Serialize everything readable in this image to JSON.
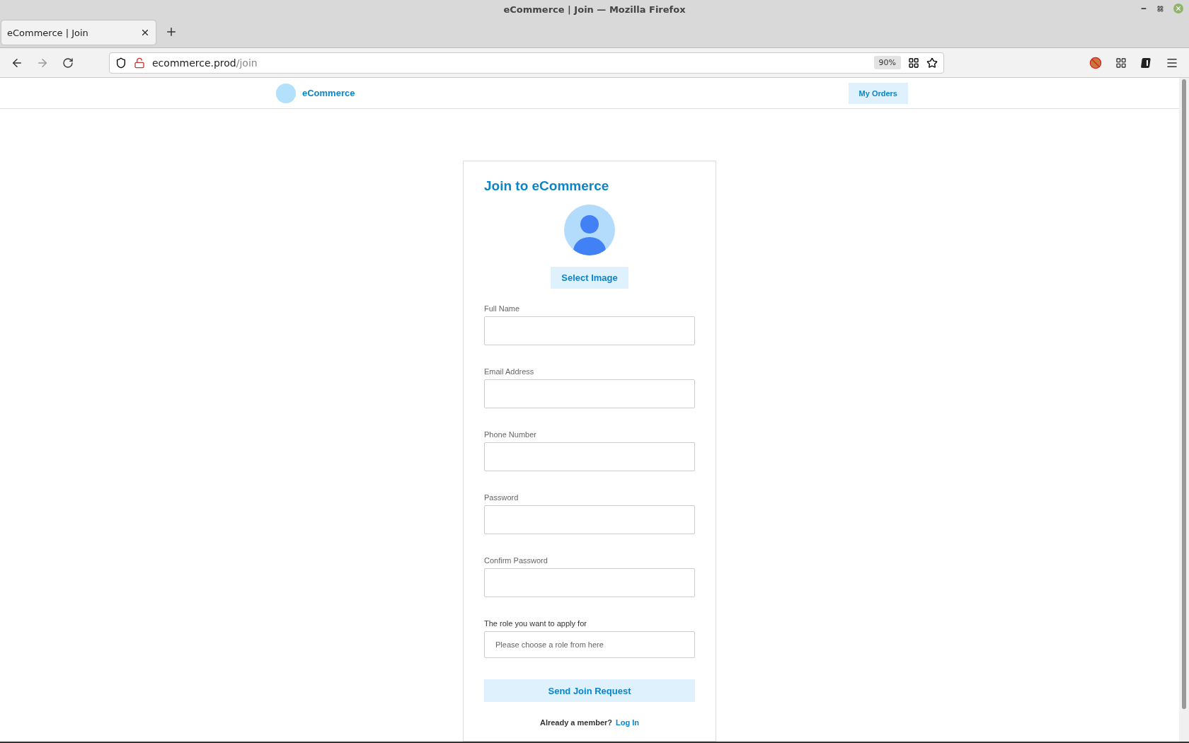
{
  "window": {
    "title": "eCommerce | Join — Mozilla Firefox"
  },
  "tabs": [
    {
      "label": "eCommerce | Join",
      "selected": true
    }
  ],
  "address_bar": {
    "host": "ecommerce.prod",
    "path": "/join",
    "zoom": "90%"
  },
  "header": {
    "brand": "eCommerce",
    "nav_button": "My Orders"
  },
  "form": {
    "title": "Join to eCommerce",
    "select_image": "Select Image",
    "fields": [
      {
        "label": "Full Name",
        "kind": "input"
      },
      {
        "label": "Email Address",
        "kind": "input"
      },
      {
        "label": "Phone Number",
        "kind": "input"
      },
      {
        "label": "Password",
        "kind": "input"
      },
      {
        "label": "Confirm Password",
        "kind": "input"
      },
      {
        "label": "The role you want to apply for",
        "kind": "select",
        "placeholder": "Please choose a role from here"
      }
    ],
    "submit": "Send Join Request",
    "footer_text": "Already a member?",
    "footer_link": "Log In"
  }
}
